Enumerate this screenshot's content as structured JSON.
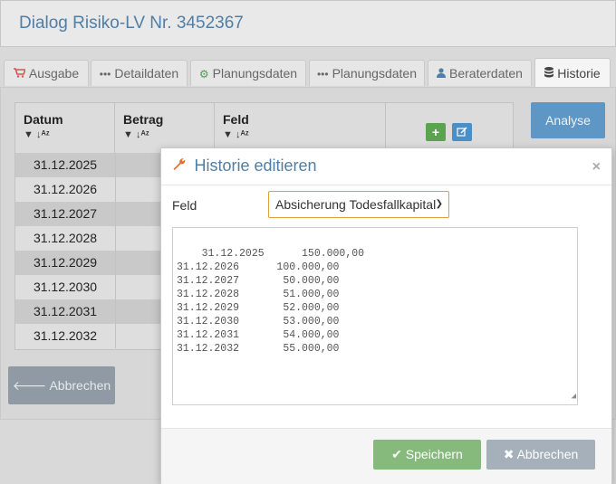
{
  "page": {
    "title": "Dialog Risiko-LV Nr. 3452367"
  },
  "tabs": [
    {
      "label": "Ausgabe",
      "icon": "cart-icon"
    },
    {
      "label": "Detaildaten",
      "icon": "ellipsis-icon"
    },
    {
      "label": "Planungsdaten",
      "icon": "gear-icon"
    },
    {
      "label": "Planungsdaten",
      "icon": "ellipsis-icon"
    },
    {
      "label": "Beraterdaten",
      "icon": "user-icon"
    },
    {
      "label": "Historie",
      "icon": "database-icon",
      "active": true
    }
  ],
  "table": {
    "headers": [
      "Datum",
      "Betrag",
      "Feld"
    ],
    "rows": [
      "31.12.2025",
      "31.12.2026",
      "31.12.2027",
      "31.12.2028",
      "31.12.2029",
      "31.12.2030",
      "31.12.2031",
      "31.12.2032"
    ]
  },
  "analyse_label": "Analyse",
  "background_cancel_label": "Abbrechen",
  "modal": {
    "title": "Historie editieren",
    "close_label": "×",
    "field_label": "Feld",
    "field_value": "Absicherung Todesfallkapital",
    "history_text": "31.12.2025      150.000,00\n31.12.2026      100.000,00\n31.12.2027       50.000,00\n31.12.2028       51.000,00\n31.12.2029       52.000,00\n31.12.2030       53.000,00\n31.12.2031       54.000,00\n31.12.2032       55.000,00",
    "save_label": "Speichern",
    "cancel_label": "Abbrechen"
  },
  "colors": {
    "accent": "#4f7ea6",
    "save": "#86b97c",
    "cancel": "#a5b0ba",
    "analyse": "#5e97c6",
    "select_border": "#e0a13a"
  }
}
